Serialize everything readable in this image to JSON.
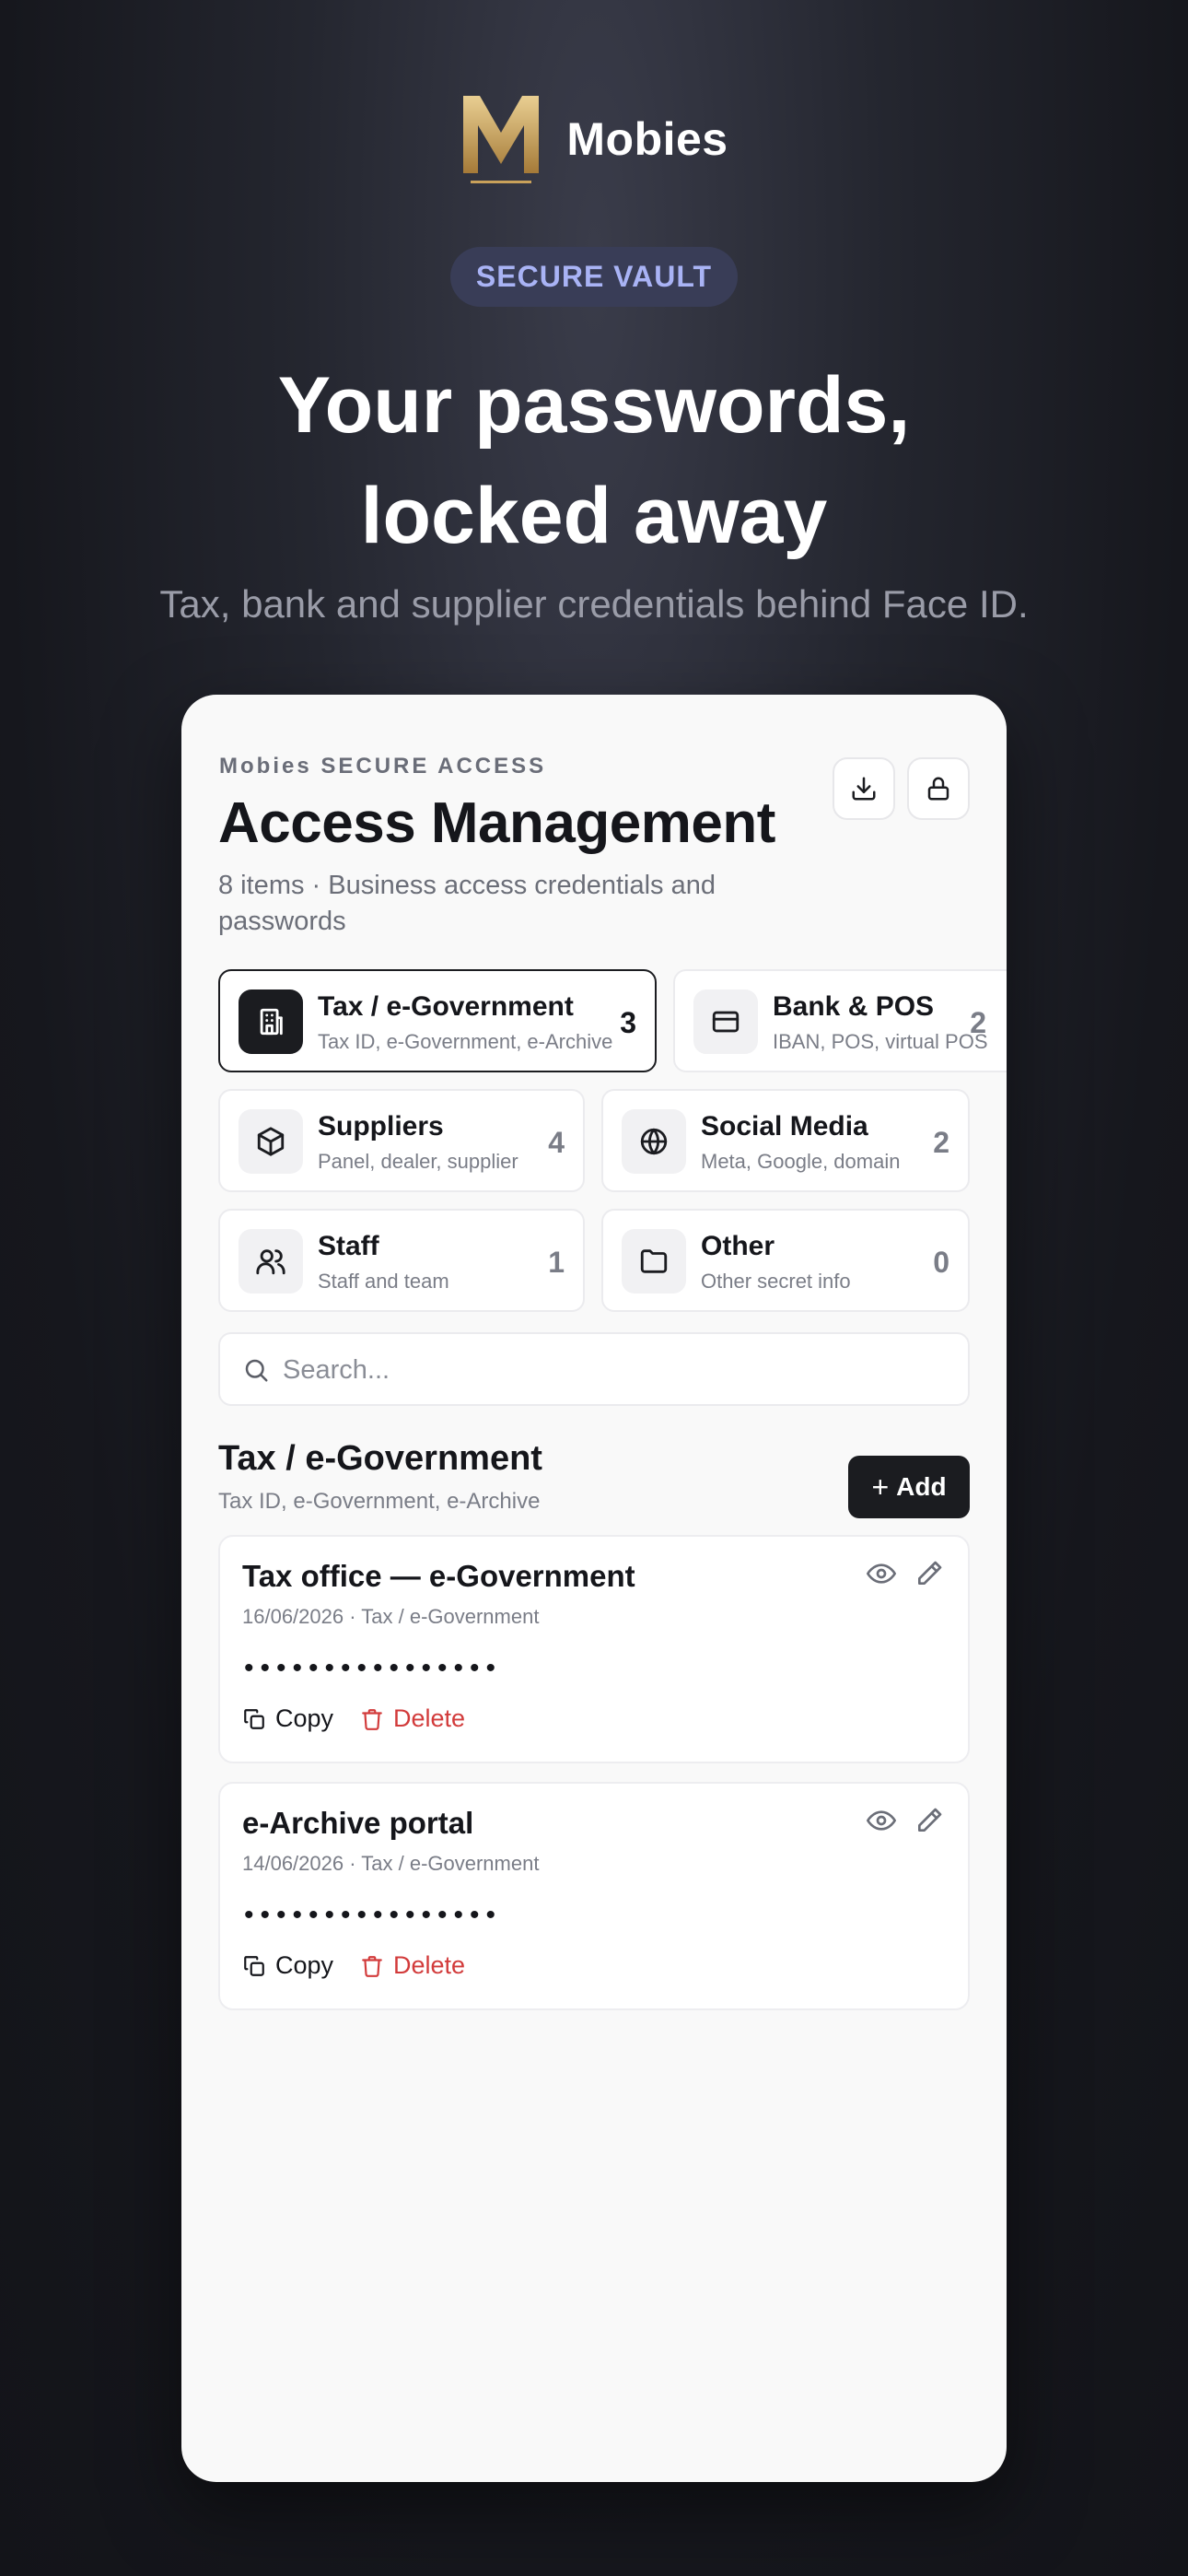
{
  "brand": {
    "name": "Mobies",
    "logo_letter": "M"
  },
  "badge": "SECURE VAULT",
  "hero": {
    "title_line1": "Your passwords,",
    "title_line2": "locked away",
    "subtitle": "Tax, bank and supplier credentials behind Face ID."
  },
  "card": {
    "eyebrow": "Mobies SECURE ACCESS",
    "title": "Access Management",
    "subtitle": "8 items · Business access credentials and passwords",
    "buttons": {
      "download_icon": "download-icon",
      "lock_icon": "lock-icon"
    },
    "categories": [
      {
        "name": "Tax / e-Government",
        "desc": "Tax ID, e-Government, e-Archive",
        "count": "3",
        "icon": "building-icon",
        "active": true
      },
      {
        "name": "Bank & POS",
        "desc": "IBAN, POS, virtual POS",
        "count": "2",
        "icon": "credit-card-icon"
      },
      {
        "name": "Suppliers",
        "desc": "Panel, dealer, supplier",
        "count": "4",
        "icon": "package-icon"
      },
      {
        "name": "Social Media",
        "desc": "Meta, Google, domain",
        "count": "2",
        "icon": "globe-icon"
      },
      {
        "name": "Staff",
        "desc": "Staff and team",
        "count": "1",
        "icon": "users-icon"
      },
      {
        "name": "Other",
        "desc": "Other secret info",
        "count": "0",
        "icon": "folder-icon"
      }
    ],
    "search": {
      "placeholder": "Search..."
    },
    "section": {
      "title": "Tax / e-Government",
      "subtitle": "Tax ID, e-Government, e-Archive",
      "add_label": "Add"
    },
    "items": [
      {
        "name": "Tax office — e-Government",
        "meta": "16/06/2026 · Tax / e-Government",
        "password": "••••••••••••••••",
        "copy_label": "Copy",
        "delete_label": "Delete"
      },
      {
        "name": "e-Archive portal",
        "meta": "14/06/2026 · Tax / e-Government",
        "password": "••••••••••••••••",
        "copy_label": "Copy",
        "delete_label": "Delete"
      }
    ]
  },
  "colors": {
    "accent_gold": "#c9a15a",
    "badge_bg": "#393d57",
    "badge_text": "#a9b3f5",
    "danger": "#d23b3b",
    "dark": "#1b1c20"
  }
}
